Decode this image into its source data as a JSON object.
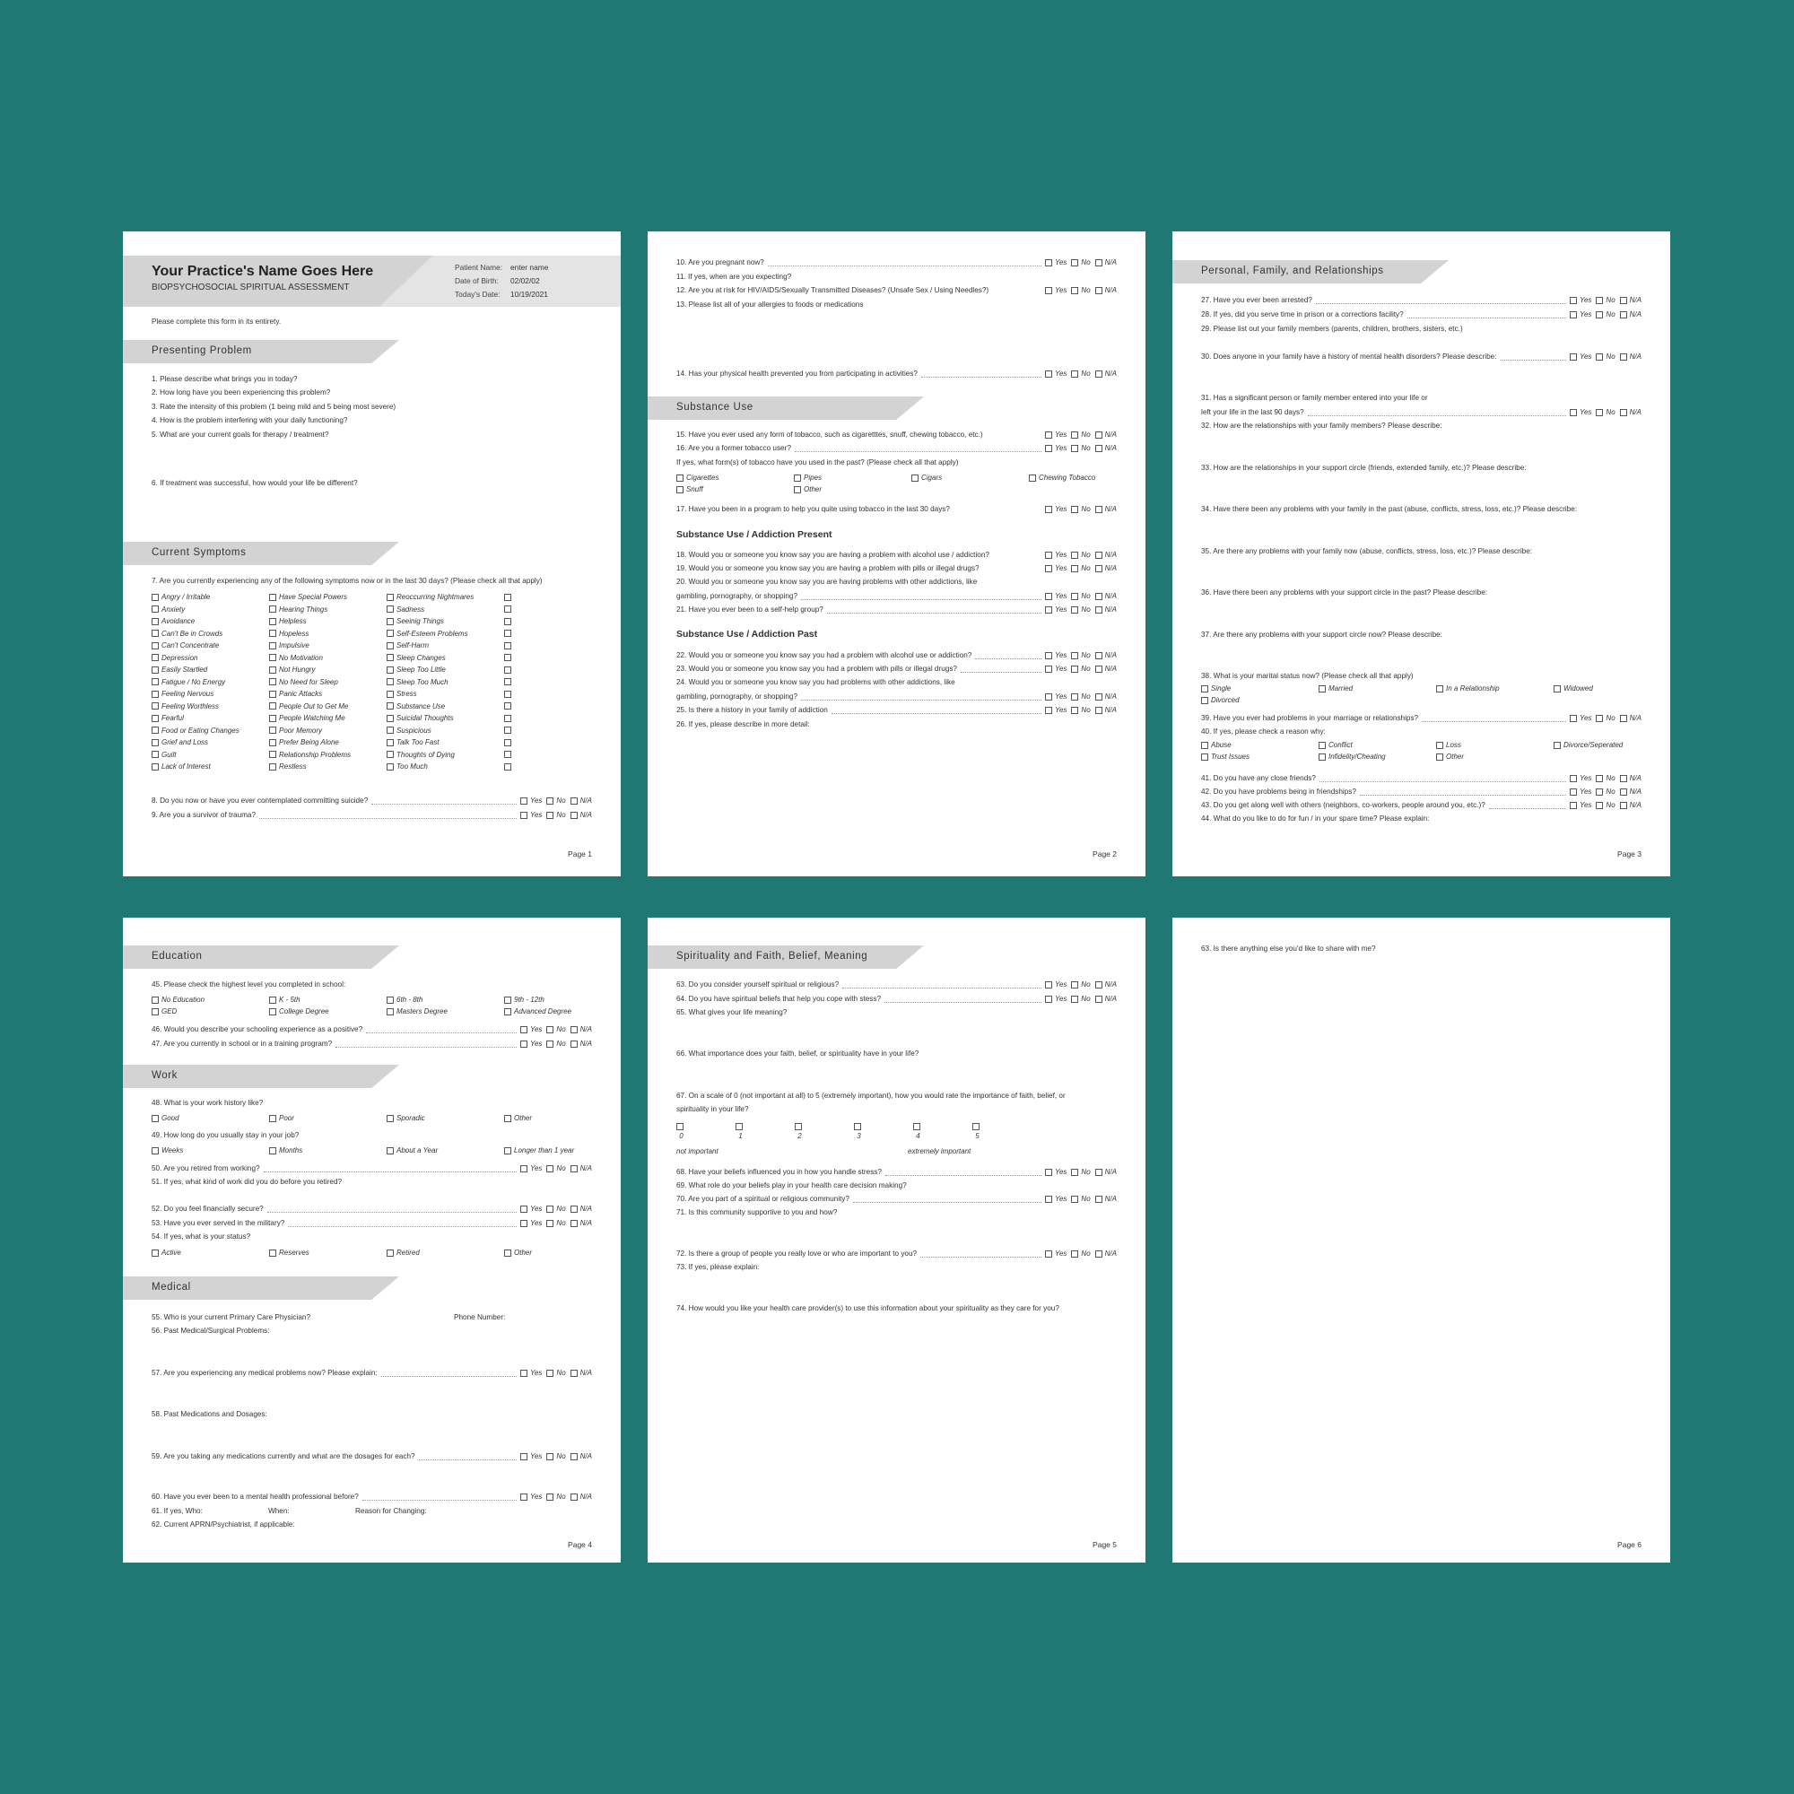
{
  "yn_labels": {
    "yes": "Yes",
    "no": "No",
    "na": "N/A"
  },
  "page1": {
    "title": "Your Practice's Name Goes Here",
    "subtitle": "BIOPSYCHOSOCIAL SPIRITUAL ASSESSMENT",
    "patient_info": [
      {
        "label": "Patient Name:",
        "value": "enter name"
      },
      {
        "label": "Date of Birth:",
        "value": "02/02/02"
      },
      {
        "label": "Today's Date:",
        "value": "10/19/2021"
      }
    ],
    "instruction": "Please complete this form in its entirety.",
    "section_presenting": "Presenting Problem",
    "presenting_questions": [
      "1. Please describe what brings you in today?",
      "2. How long have you been experiencing this problem?",
      "3. Rate the intensity of this problem (1 being mild and 5 being most severe)",
      "4. How is the problem interfering with your daily functioning?",
      "5. What are your current goals for therapy / treatment?"
    ],
    "q6": "6. If treatment was successful, how would your life be different?",
    "section_symptoms": "Current Symptoms",
    "q7": "7. Are you currently experiencing any of the following symptoms now or in the last 30 days? (Please check all that apply)",
    "symptoms_col1": [
      "Angry / Irritable",
      "Anxiety",
      "Avoidance",
      "Can't Be in Crowds",
      "Can't Concentrate",
      "Depression",
      "Easily Startled",
      "Fatigue / No Energy",
      "Feeling Nervous",
      "Feeling Worthless",
      "Fearful",
      "Food or Eating Changes",
      "Grief and Loss",
      "Guilt",
      "Lack of Interest"
    ],
    "symptoms_col2": [
      "Have Special Powers",
      "Hearing Things",
      "Helpless",
      "Hopeless",
      "Impulsive",
      "No Motivation",
      "Not Hungry",
      "No Need for Sleep",
      "Panic Attacks",
      "People Out to Get Me",
      "People Watching Me",
      "Poor Memory",
      "Prefer Being Alone",
      "Relationship Problems",
      "Restless"
    ],
    "symptoms_col3": [
      "Reoccurring Nightmares",
      "Sadness",
      "Seeinig Things",
      "Self-Esteem Problems",
      "Self-Harm",
      "Sleep Changes",
      "Sleep Too Little",
      "Sleep Too Much",
      "Stress",
      "Substance Use",
      "Suicidal Thoughts",
      "Suspicious",
      "Talk Too Fast",
      "Thoughts of Dying",
      "Too Much"
    ],
    "q8": "8. Do you now or have you ever contemplated committing suicide?",
    "q9": "9. Are you a survivor of trauma?",
    "page_label": "Page 1"
  },
  "page2": {
    "q10": "10. Are you pregnant now?",
    "q11": "11. If yes, when are you expecting?",
    "q12": "12. Are you at risk for HIV/AIDS/Sexually Transmitted Diseases? (Unsafe Sex / Using Needles?)",
    "q13": "13. Please list all of your allergies to foods or medications",
    "q14": "14. Has your physical health prevented you from participating in activities?",
    "section_substance": "Substance Use",
    "q15": "15. Have you ever used any form of tobacco, such as cigaretttes, snuff, chewing tobacco, etc.)",
    "q16": "16. Are you a former tobacco user?",
    "q16b": "If yes, what form(s) of tobacco have you used in the past? (Please check all that apply)",
    "tobacco_options": [
      "Cigarettes",
      "Pipes",
      "Cigars",
      "Chewing Tobacco",
      "Snuff",
      "Other"
    ],
    "q17": "17. Have you been in a program to help you quite using tobacco in the last 30 days?",
    "sub_present": "Substance Use / Addiction Present",
    "q18": "18. Would you or someone you know say you are having a problem with alcohol use / addiction?",
    "q19": "19. Would you or someone you know say you are having a problem with pills or illegal drugs?",
    "q20a": "20. Would you or someone you know say you are having problems with other addictions, like",
    "q20b": "gambling, pornography, or shopping?",
    "q21": "21. Have you ever been to a self-help group?",
    "sub_past": "Substance Use / Addiction Past",
    "q22": "22. Would you or someone you know say you had a problem with alcohol use or addiction?",
    "q23": "23. Would you or someone you know say you had a problem with pills or illegal drugs?",
    "q24a": "24. Would you or someone you know say you had problems with other addictions, like",
    "q24b": "gambling, pornography, or shopping?",
    "q25": "25. Is there a history in your family of addiction",
    "q26": "26. If yes, please describe in more detail:",
    "page_label": "Page 2"
  },
  "page3": {
    "section": "Personal, Family, and Relationships",
    "q27": "27. Have you ever been arrested?",
    "q28": "28. If yes, did you serve time in prison or a corrections facility?",
    "q29": "29. Please list out your family members (parents, children, brothers, sisters, etc.)",
    "q30": "30. Does anyone in your family have a history of mental health disorders? Please describe:",
    "q31a": "31. Has a significant person or family member entered into your life or",
    "q31b": "left your life in the last 90 days?",
    "q32": "32. How are the relationships with your family members? Please describe:",
    "q33": "33. How are the relationships in your support circle (friends, extended family, etc.)? Please describe:",
    "q34": "34. Have there been any problems with your family in the past (abuse, conflicts, stress, loss, etc.)? Please describe:",
    "q35": "35. Are there any problems with your family now (abuse, conflicts, stress, loss, etc.)? Please describe:",
    "q36": "36. Have there been any problems with your support circle in the past? Please describe:",
    "q37": "37. Are there any problems with your support circle now? Please describe:",
    "q38": "38. What is your marital status now? (Please check all that apply)",
    "marital_options": [
      "Single",
      "Married",
      "In a Relationship",
      "Widowed",
      "Divorced"
    ],
    "q39": "39. Have you ever had problems in your marriage or relationships?",
    "q40": "40. If yes, please check a reason why:",
    "reason_options": [
      "Abuse",
      "Conflict",
      "Loss",
      "Divorce/Seperated",
      "Trust Issues",
      "Infidelity/Cheating",
      "Other"
    ],
    "q41": "41. Do you have any close friends?",
    "q42": "42. Do you have problems being in friendships?",
    "q43": "43. Do you get along well with others (neighbors, co-workers, people around you, etc.)?",
    "q44": "44. What do you like to do for fun / in your spare time? Please explain:",
    "page_label": "Page 3"
  },
  "page4": {
    "section_education": "Education",
    "q45": "45. Please check the highest level you completed in school:",
    "education_options": [
      "No Education",
      "K - 5th",
      "6th - 8th",
      "9th - 12th",
      "GED",
      "College Degree",
      "Masters Degree",
      "Advanced Degree"
    ],
    "q46": "46. Would you describe your schooling experience as a positive?",
    "q47": "47. Are you currently in school or in a training program?",
    "section_work": "Work",
    "q48": "48. What is your work history like?",
    "work_history_options": [
      "Good",
      "Poor",
      "Sporadic",
      "Other"
    ],
    "q49": "49. How long do you usually stay in your job?",
    "job_length_options": [
      "Weeks",
      "Months",
      "About a Year",
      "Longer than 1 year"
    ],
    "q50": "50. Are you retired from working?",
    "q51": "51. If yes, what kind of work did you do before you retired?",
    "q52": "52. Do you feel financially secure?",
    "q53": "53. Have you ever served in the military?",
    "q54": "54. If yes, what is your status?",
    "military_options": [
      "Active",
      "Reserves",
      "Retired",
      "Other"
    ],
    "section_medical": "Medical",
    "q55": "55. Who is your current Primary Care Physician?",
    "q55_phone": "Phone Number:",
    "q56": "56. Past Medical/Surgical Problems:",
    "q57": "57. Are you experiencing any medical problems now? Please explain:",
    "q58": "58. Past Medications and Dosages:",
    "q59": "59. Are you taking any medications currently and what are the dosages for each?",
    "q60": "60. Have you ever been to a mental health professional before?",
    "q61": "61. If yes, Who:",
    "q61_when": "When:",
    "q61_reason": "Reason for Changing:",
    "q62": "62. Current APRN/Psychiatrist, if applicable:",
    "page_label": "Page 4"
  },
  "page5": {
    "section": "Spirituality and Faith, Belief, Meaning",
    "q63": "63. Do you consider yourself spiritual or religious?",
    "q64": "64. Do you have spiritual beliefs that help you cope with stess?",
    "q65": "65. What gives your life meaning?",
    "q66": "66. What importance does your faith, belief, or spirituality have in your life?",
    "q67a": "67. On a scale of 0 (not important at all) to 5 (extremely important), how you would rate the importance of faith, belief, or",
    "q67b": "spirituality in your life?",
    "scale_values": [
      "0",
      "1",
      "2",
      "3",
      "4",
      "5"
    ],
    "scale_low": "not important",
    "scale_high": "extremely important",
    "q68": "68. Have your beliefs influenced you in how you handle stress?",
    "q69": "69. What role do your beliefs play in your health care decision making?",
    "q70": "70. Are you part of a spiritual or religious community?",
    "q71": "71. Is this community supportive to you and how?",
    "q72": "72. Is there a group of people you really love or who are important to you?",
    "q73": "73. If yes, please explain:",
    "q74": "74. How would you like your health care provider(s) to use this information about your spirituality as they care for you?",
    "page_label": "Page 5"
  },
  "page6": {
    "q63": "63. Is there anything else you'd like to share with me?",
    "page_label": "Page 6"
  }
}
